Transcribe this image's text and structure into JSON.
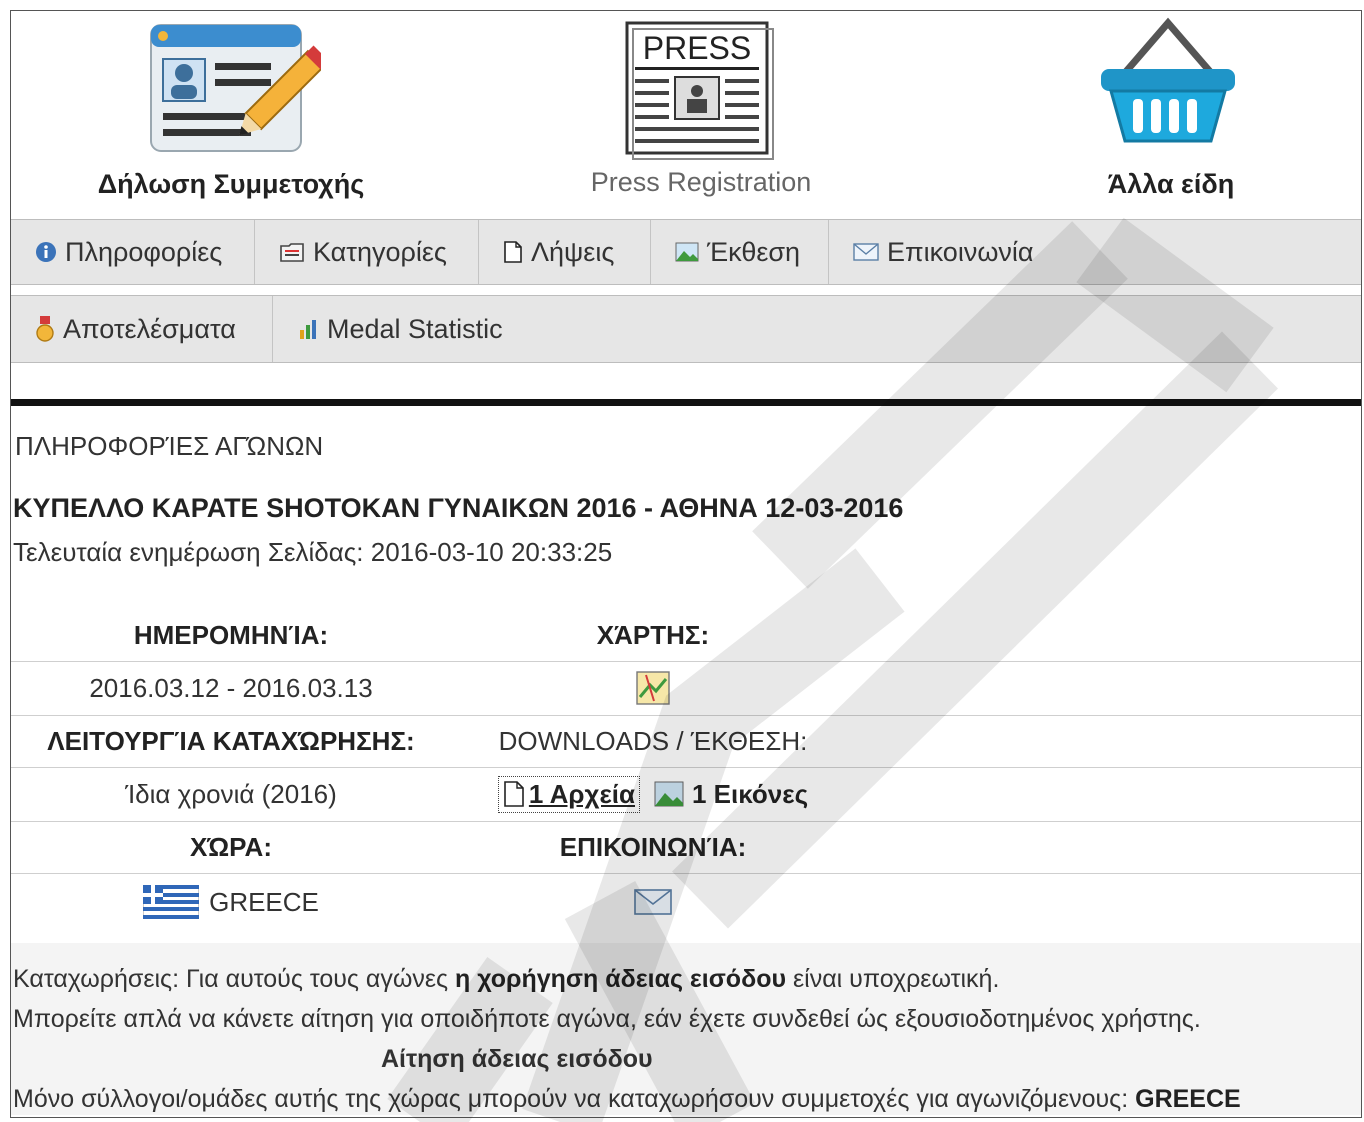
{
  "top": {
    "participation": "Δήλωση Συμμετοχής",
    "press_badge": "PRESS",
    "press_registration": "Press Registration",
    "other_items": "Άλλα είδη"
  },
  "nav": {
    "row1": [
      "Πληροφορίες",
      "Κατηγορίες",
      "Λήψεις",
      "Έκθεση",
      "Επικοινωνία"
    ],
    "row2": [
      "Αποτελέσματα",
      "Medal Statistic"
    ]
  },
  "info": {
    "section_title": "ΠΛΗΡΟΦΟΡΊΕΣ ΑΓΏΝΩΝ",
    "event_title": "ΚΥΠΕΛΛΟ ΚΑΡΑΤΕ SHOTOKAN ΓΥΝΑΙΚΩΝ 2016 - ΑΘΗΝΑ 12-03-2016",
    "last_update": "Τελευταία ενημέρωση Σελίδας: 2016-03-10 20:33:25"
  },
  "table": {
    "date_label": "ΗΜΕΡΟΜΗΝΊΑ:",
    "date_value": "2016.03.12 - 2016.03.13",
    "map_label": "ΧΆΡΤΗΣ:",
    "reg_label": "ΛΕΙΤΟΥΡΓΊΑ ΚΑΤΑΧΏΡΗΣΗΣ:",
    "reg_value": "Ίδια χρονιά (2016)",
    "downloads_label": "DOWNLOADS / ΈΚΘΕΣΗ:",
    "files_link": "1 Αρχεία",
    "images_link": "1 Εικόνες",
    "country_label": "ΧΏΡΑ:",
    "country_value": "GREECE",
    "contact_label": "ΕΠΙΚΟΙΝΩΝΊΑ:"
  },
  "notice": {
    "line1_a": "Καταχωρήσεις: Για αυτούς τους αγώνες ",
    "line1_b": "η χορήγηση άδειας εισόδου",
    "line1_c": " είναι υποχρεωτική.",
    "line2": "Μπορείτε απλά να κάνετε αίτηση για οποιδήποτε αγώνα, εάν έχετε συνδεθεί ώς εξουσιοδοτημένος χρήστης.",
    "apply_link": "Αίτηση άδειας εισόδου",
    "line4_a": "Μόνο σύλλογοι/ομάδες αυτής της χώρας μπορούν να καταχωρήσουν συμμετοχές για αγωνιζόμενους: ",
    "line4_b": "GREECE"
  },
  "icons": {
    "participation": "registration-form-icon",
    "press": "press-newspaper-icon",
    "shop": "shopping-basket-icon",
    "info": "info-icon",
    "categories": "folder-icon",
    "downloads": "document-icon",
    "gallery": "picture-icon",
    "contact": "envelope-icon",
    "results": "medal-icon",
    "stats": "bar-chart-icon",
    "map": "map-icon",
    "flag": "greek-flag-icon"
  },
  "colors": {
    "nav_bg": "#e6e6e6",
    "rule": "#111111",
    "notice_bg": "#f4f4f4"
  }
}
